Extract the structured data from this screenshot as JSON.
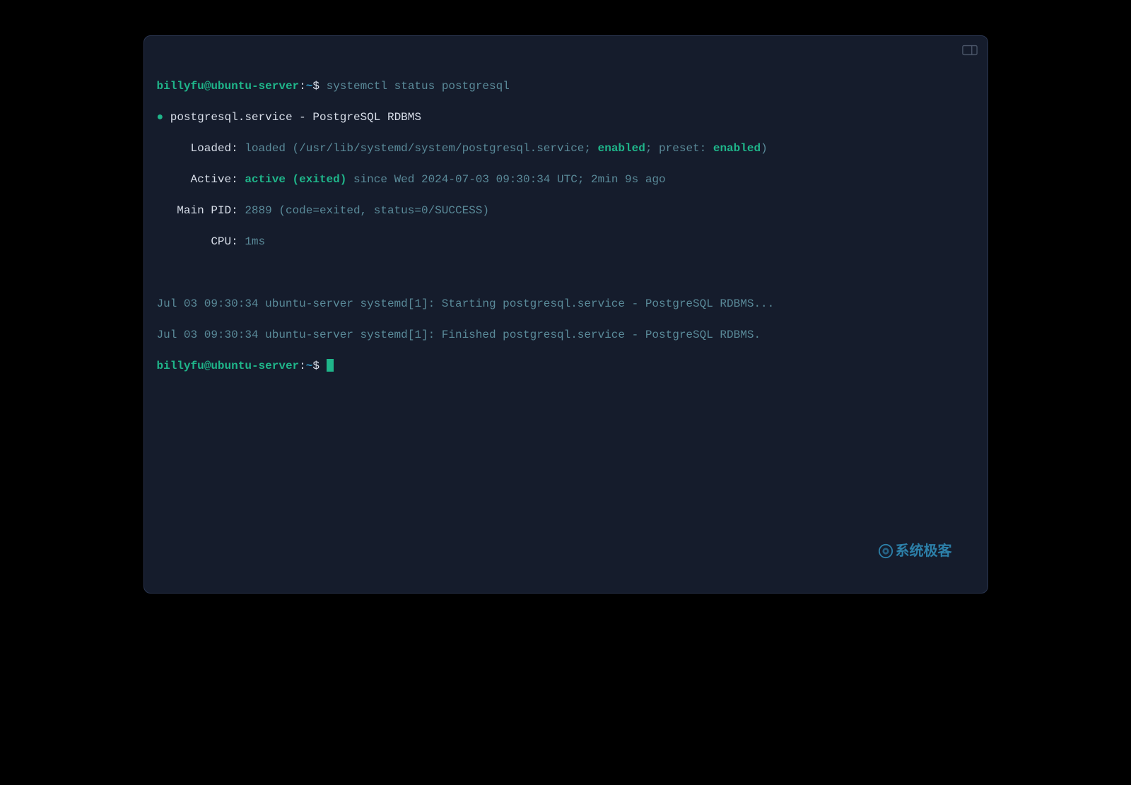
{
  "prompt": {
    "user": "billyfu",
    "at": "@",
    "host": "ubuntu-server",
    "colon": ":",
    "path": "~",
    "symbol": "$"
  },
  "command1": "systemctl status postgresql",
  "status": {
    "dot": "●",
    "service_line": " postgresql.service - PostgreSQL RDBMS",
    "loaded_label": "     Loaded: ",
    "loaded_value": "loaded (/usr/lib/systemd/system/postgresql.service; ",
    "enabled1": "enabled",
    "loaded_mid": "; preset: ",
    "enabled2": "enabled",
    "loaded_end": ")",
    "active_label": "     Active: ",
    "active_value": "active (exited)",
    "active_rest": " since Wed 2024-07-03 09:30:34 UTC; 2min 9s ago",
    "mainpid": "   Main PID: 2889 (code=exited, status=0/SUCCESS)",
    "cpu": "        CPU: 1ms"
  },
  "log": {
    "line1": "Jul 03 09:30:34 ubuntu-server systemd[1]: Starting postgresql.service - PostgreSQL RDBMS...",
    "line2": "Jul 03 09:30:34 ubuntu-server systemd[1]: Finished postgresql.service - PostgreSQL RDBMS."
  },
  "watermark": {
    "text": "系统极客"
  }
}
